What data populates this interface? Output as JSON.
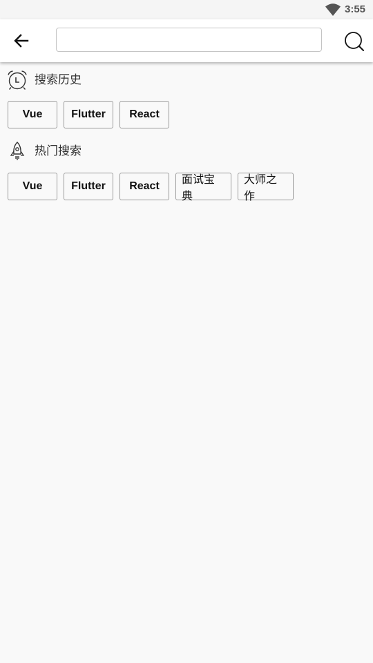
{
  "status_bar": {
    "time": "3:55",
    "wifi_icon": "wifi-icon"
  },
  "app_bar": {
    "back_icon": "arrow-left-icon",
    "search_value": "",
    "search_placeholder": "",
    "search_icon": "search-icon"
  },
  "history": {
    "title": "搜索历史",
    "icon": "alarm-clock-icon",
    "items": [
      "Vue",
      "Flutter",
      "React"
    ]
  },
  "hot": {
    "title": "热门搜索",
    "icon": "rocket-icon",
    "items": [
      "Vue",
      "Flutter",
      "React",
      "面试宝典",
      "大师之作"
    ]
  },
  "colors": {
    "background": "#f9f9f9",
    "chip_border": "#999999",
    "status_text": "#555555"
  }
}
